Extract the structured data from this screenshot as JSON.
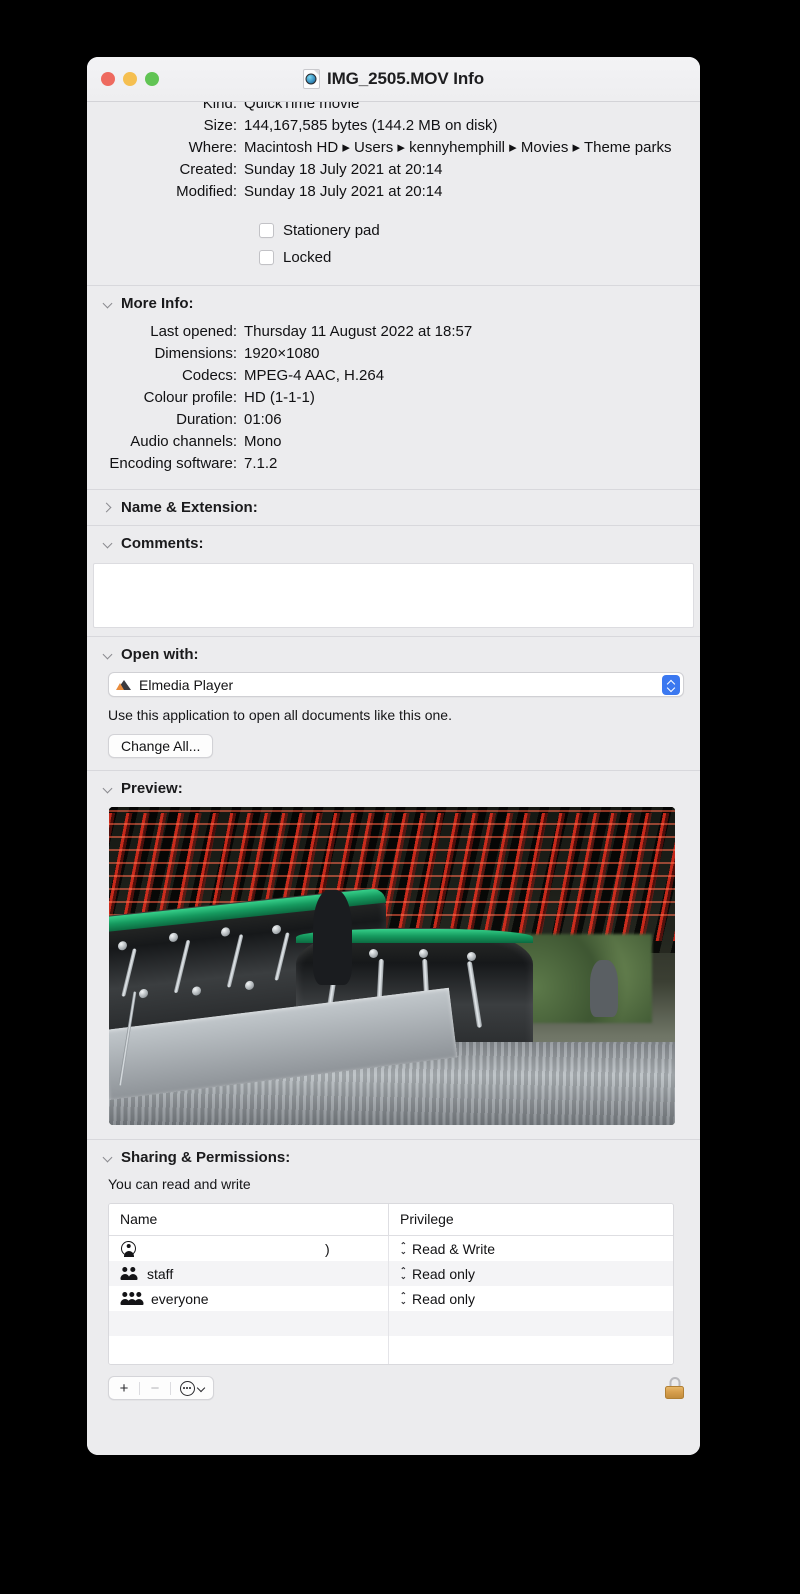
{
  "window": {
    "title": "IMG_2505.MOV Info",
    "title_icon": "quicktime-movie-file-icon",
    "traffic_lights": [
      "close",
      "minimize",
      "zoom"
    ]
  },
  "general": {
    "rows": [
      {
        "label": "Kind:",
        "value": "QuickTime movie"
      },
      {
        "label": "Size:",
        "value": "144,167,585 bytes (144.2 MB on disk)"
      },
      {
        "label": "Where:",
        "value": "Macintosh HD ▸ Users ▸ kennyhemphill ▸ Movies ▸ Theme parks"
      },
      {
        "label": "Created:",
        "value": "Sunday 18 July 2021 at 20:14"
      },
      {
        "label": "Modified:",
        "value": "Sunday 18 July 2021 at 20:14"
      }
    ],
    "checkboxes": [
      {
        "label": "Stationery pad",
        "checked": false
      },
      {
        "label": "Locked",
        "checked": false
      }
    ]
  },
  "more_info": {
    "header": "More Info:",
    "expanded": true,
    "rows": [
      {
        "label": "Last opened:",
        "value": "Thursday 11 August 2022 at 18:57"
      },
      {
        "label": "Dimensions:",
        "value": "1920×1080"
      },
      {
        "label": "Codecs:",
        "value": "MPEG-4 AAC, H.264"
      },
      {
        "label": "Colour profile:",
        "value": "HD (1-1-1)"
      },
      {
        "label": "Duration:",
        "value": "01:06"
      },
      {
        "label": "Audio channels:",
        "value": "Mono"
      },
      {
        "label": "Encoding software:",
        "value": "7.1.2"
      }
    ]
  },
  "name_extension": {
    "header": "Name & Extension:",
    "expanded": false
  },
  "comments": {
    "header": "Comments:",
    "expanded": true,
    "value": "",
    "placeholder": ""
  },
  "open_with": {
    "header": "Open with:",
    "expanded": true,
    "selected_app": "Elmedia Player",
    "app_icon": "elmedia-player-icon",
    "note": "Use this application to open all documents like this one.",
    "change_all_label": "Change All..."
  },
  "preview": {
    "header": "Preview:",
    "expanded": true,
    "description": "fairground-waltzer-ride-photo"
  },
  "sharing": {
    "header": "Sharing & Permissions:",
    "expanded": true,
    "note": "You can read and write",
    "columns": [
      "Name",
      "Privilege"
    ],
    "rows": [
      {
        "icon": "user-icon",
        "name": ")",
        "redacted": true,
        "privilege": "Read & Write"
      },
      {
        "icon": "group-icon",
        "name": "staff",
        "redacted": false,
        "privilege": "Read only"
      },
      {
        "icon": "everyone-icon",
        "name": "everyone",
        "redacted": false,
        "privilege": "Read only"
      },
      {
        "icon": "",
        "name": "",
        "redacted": false,
        "privilege": ""
      },
      {
        "icon": "",
        "name": "",
        "redacted": false,
        "privilege": ""
      }
    ],
    "toolbar": {
      "add_label": "+",
      "remove_label": "−",
      "action_icon": "action-menu-icon",
      "lock_icon": "locked-padlock-icon",
      "lock_state": "locked"
    }
  },
  "colors": {
    "window_bg": "#ececee",
    "close": "#ee6a5f",
    "minimize": "#f5bf50",
    "zoom": "#61c454",
    "accent_blue": "#3b78f0",
    "lock_gold": "#d79f4d"
  }
}
